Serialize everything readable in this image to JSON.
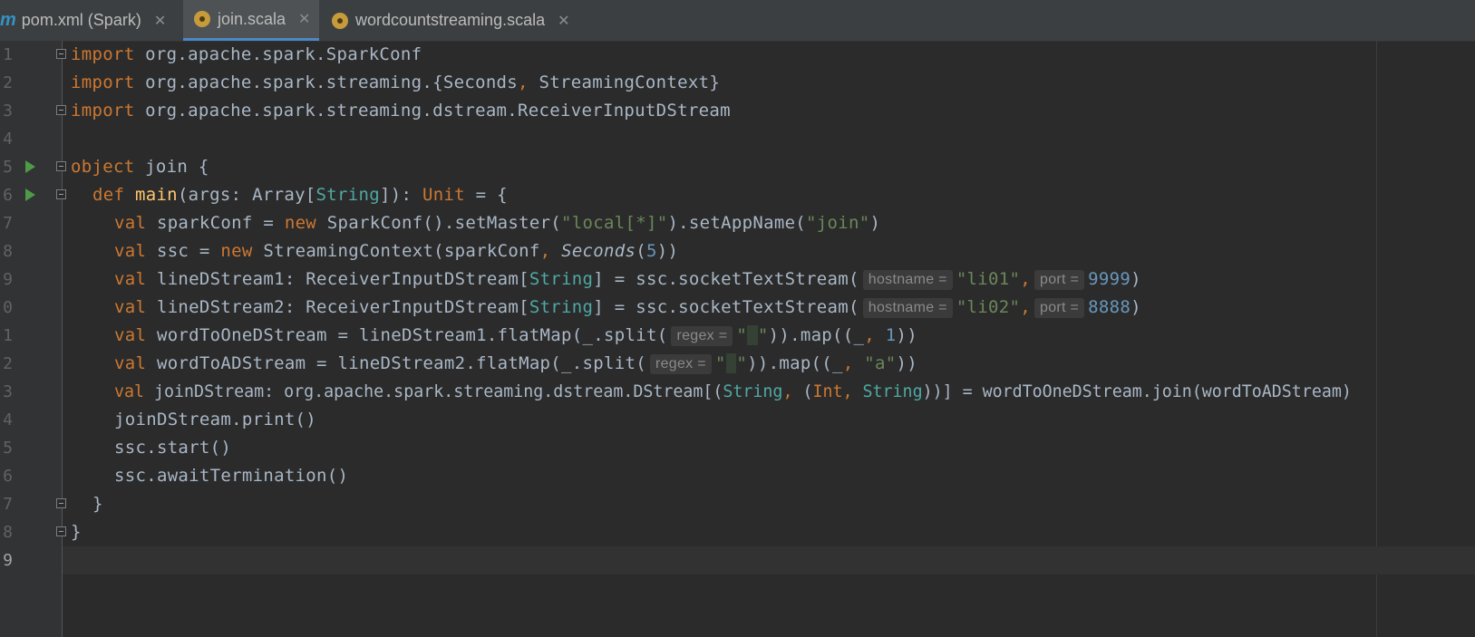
{
  "tabs": [
    {
      "label": "pom.xml (Spark)",
      "icon": "maven-icon",
      "active": false
    },
    {
      "label": "join.scala",
      "icon": "scala-object-icon",
      "active": true
    },
    {
      "label": "wordcountstreaming.scala",
      "icon": "scala-object-icon",
      "active": false
    }
  ],
  "line_numbers": [
    "1",
    "2",
    "3",
    "4",
    "5",
    "6",
    "7",
    "8",
    "9",
    "0",
    "1",
    "2",
    "3",
    "4",
    "5",
    "6",
    "7",
    "8",
    "9"
  ],
  "code": {
    "l1": {
      "kw": "import",
      "rest": " org.apache.spark.SparkConf"
    },
    "l2": {
      "kw": "import",
      "a": " org.apache.spark.streaming.{Seconds",
      "comma": ",",
      "b": " StreamingContext}"
    },
    "l3": {
      "kw": "import",
      "rest": " org.apache.spark.streaming.dstream.ReceiverInputDStream"
    },
    "l5": {
      "kw": "object",
      "rest": " join {"
    },
    "l6": {
      "kw": "def",
      "fn": "main",
      "a": "(args: Array[",
      "typ": "String",
      "b": "]): ",
      "unit": "Unit",
      "c": " = {"
    },
    "l7": {
      "kw": "val",
      "a": " sparkConf = ",
      "new": "new",
      "b": " SparkConf().setMaster(",
      "s1": "\"local[*]\"",
      "c": ").setAppName(",
      "s2": "\"join\"",
      "d": ")"
    },
    "l8": {
      "kw": "val",
      "a": " ssc = ",
      "new": "new",
      "b": " StreamingContext(sparkConf",
      "comma": ",",
      "it": "Seconds",
      "c": "(",
      "num": "5",
      "d": "))"
    },
    "l9": {
      "kw": "val",
      "a": " lineDStream1: ReceiverInputDStream[",
      "typ": "String",
      "b": "] = ssc.socketTextStream(",
      "h1": "hostname =",
      "s1": "\"li01\"",
      "comma": ",",
      "h2": "port =",
      "num": "9999",
      "c": ")"
    },
    "l10": {
      "kw": "val",
      "a": " lineDStream2: ReceiverInputDStream[",
      "typ": "String",
      "b": "] = ssc.socketTextStream(",
      "h1": "hostname =",
      "s1": "\"li02\"",
      "comma": ",",
      "h2": "port =",
      "num": "8888",
      "c": ")"
    },
    "l11": {
      "kw": "val",
      "a": " wordToOneDStream = lineDStream1.flatMap(_.split(",
      "h1": "regex =",
      "q1": "\"",
      "q2": "\"",
      "b": ")).map((_",
      "comma": ",",
      "num": " 1",
      "c": "))"
    },
    "l12": {
      "kw": "val",
      "a": " wordToADStream = lineDStream2.flatMap(_.split(",
      "h1": "regex =",
      "q1": "\"",
      "q2": "\"",
      "b": ")).map((_",
      "comma": ",",
      "s1": " \"a\"",
      "c": "))"
    },
    "l13": {
      "kw": "val",
      "a": " joinDStream: org.apache.spark.streaming.dstream.DStream[(",
      "t1": "String",
      "comma1": ",",
      "b": " (",
      "t2": "Int",
      "comma2": ",",
      "t3": " String",
      "c": "))] = wordToOneDStream.join(wordToADStream)"
    },
    "l14": {
      "text": "joinDStream.print()"
    },
    "l15": {
      "text": "ssc.start()"
    },
    "l16": {
      "text": "ssc.awaitTermination()"
    },
    "l17": {
      "text": "}"
    },
    "l18": {
      "text": "}"
    }
  },
  "colors": {
    "background": "#2b2b2b",
    "keyword": "#cc7832",
    "string": "#6a8759",
    "number": "#6897bb",
    "type": "#4ea9a4",
    "function": "#ffc66d",
    "text": "#a9b7c6"
  }
}
